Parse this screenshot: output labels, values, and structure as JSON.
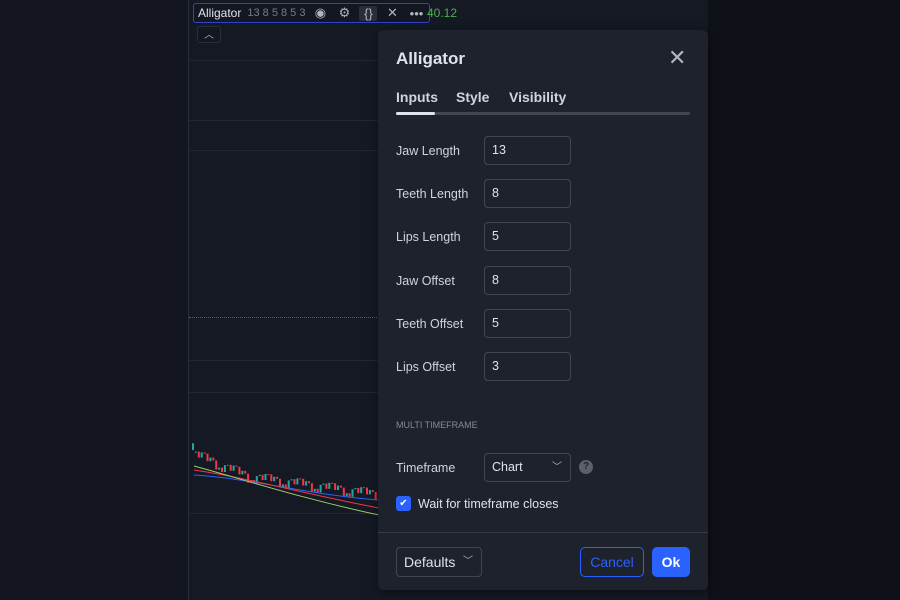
{
  "legend": {
    "name": "Alligator",
    "params": "13 8 5 8 5 3",
    "price": "40.12"
  },
  "dialog": {
    "title": "Alligator",
    "tabs": [
      "Inputs",
      "Style",
      "Visibility"
    ],
    "active_tab": "Inputs",
    "inputs": [
      {
        "label": "Jaw Length",
        "value": "13"
      },
      {
        "label": "Teeth Length",
        "value": "8"
      },
      {
        "label": "Lips Length",
        "value": "5"
      },
      {
        "label": "Jaw Offset",
        "value": "8"
      },
      {
        "label": "Teeth Offset",
        "value": "5"
      },
      {
        "label": "Lips Offset",
        "value": "3"
      }
    ],
    "section": "MULTI TIMEFRAME",
    "timeframe_label": "Timeframe",
    "timeframe_value": "Chart",
    "help": "?",
    "checkbox_label": "Wait for timeframe closes",
    "checkbox_checked": true,
    "defaults": "Defaults",
    "cancel": "Cancel",
    "ok": "Ok"
  },
  "colors": {
    "accent": "#2962ff",
    "up": "#26a69a",
    "down": "#f23645"
  }
}
